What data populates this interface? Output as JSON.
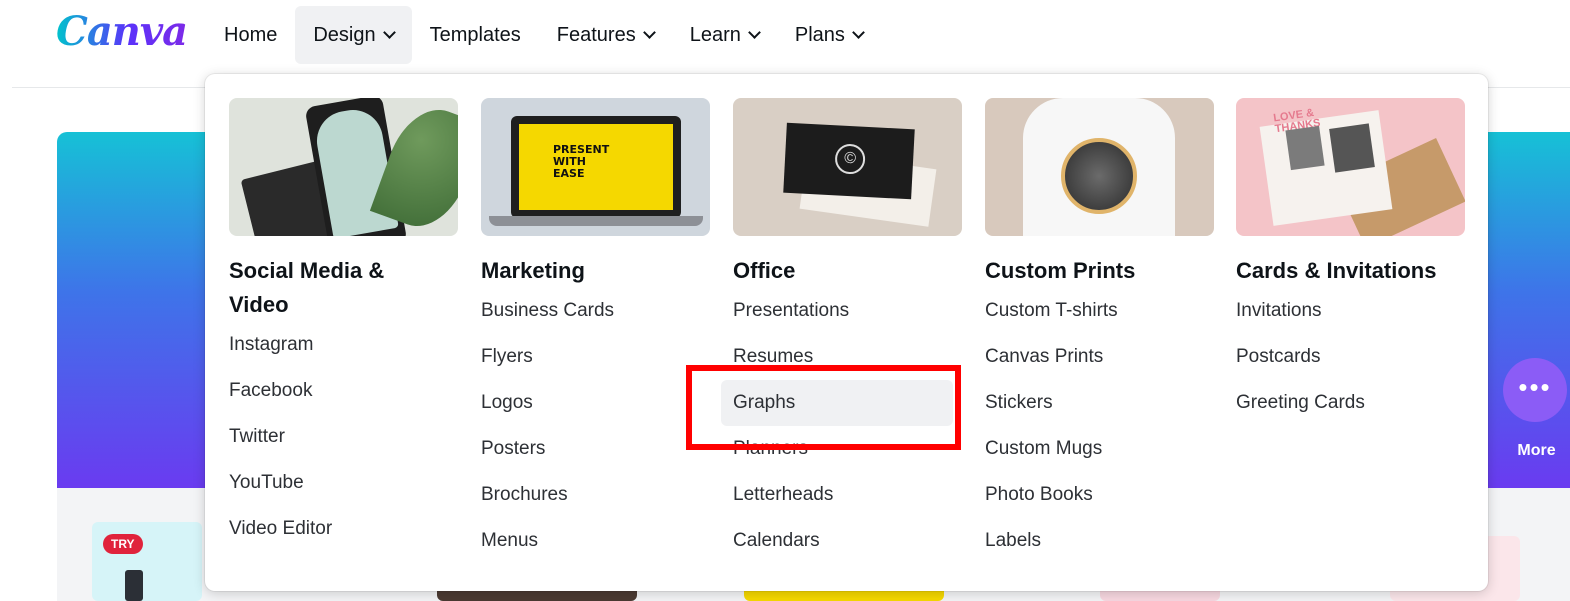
{
  "brand": {
    "logo_text": "Canva"
  },
  "nav": {
    "items": [
      {
        "label": "Home",
        "has_menu": false
      },
      {
        "label": "Design",
        "has_menu": true,
        "active": true
      },
      {
        "label": "Templates",
        "has_menu": false
      },
      {
        "label": "Features",
        "has_menu": true
      },
      {
        "label": "Learn",
        "has_menu": true
      },
      {
        "label": "Plans",
        "has_menu": true
      }
    ]
  },
  "design_menu": {
    "columns": [
      {
        "title": "Social Media & Video",
        "links": [
          "Instagram",
          "Facebook",
          "Twitter",
          "YouTube",
          "Video Editor"
        ]
      },
      {
        "title": "Marketing",
        "image_text": "PRESENT WITH EASE",
        "links": [
          "Business Cards",
          "Flyers",
          "Logos",
          "Posters",
          "Brochures",
          "Menus"
        ]
      },
      {
        "title": "Office",
        "image_text": "©",
        "links": [
          "Presentations",
          "Resumes",
          "Graphs",
          "Planners",
          "Letterheads",
          "Calendars"
        ],
        "highlighted_link": "Graphs"
      },
      {
        "title": "Custom Prints",
        "links": [
          "Custom T-shirts",
          "Canvas Prints",
          "Stickers",
          "Custom Mugs",
          "Photo Books",
          "Labels"
        ]
      },
      {
        "title": "Cards & Invitations",
        "image_text": "LOVE & THANKS",
        "links": [
          "Invitations",
          "Postcards",
          "Greeting Cards"
        ]
      }
    ]
  },
  "background": {
    "more_label": "More",
    "more_icon": "•••",
    "try_badge": "TRY"
  },
  "colors": {
    "annotation": "#ff0000",
    "hero_gradient_top": "#16c1d6",
    "hero_gradient_bottom": "#6a3bf0",
    "more_button": "#8b5cf6",
    "try_badge": "#e0233c"
  }
}
